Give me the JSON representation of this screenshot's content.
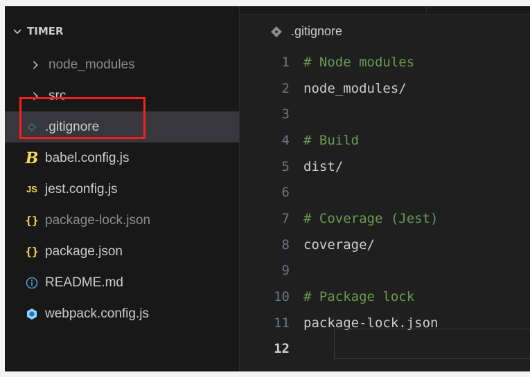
{
  "explorer": {
    "root_label": "TIMER",
    "items": [
      {
        "type": "folder",
        "label": "node_modules",
        "icon": "chevron-right-icon",
        "dimmed": true
      },
      {
        "type": "folder",
        "label": "src",
        "icon": "chevron-right-icon"
      },
      {
        "type": "file",
        "label": ".gitignore",
        "icon": "git-icon",
        "selected": true
      },
      {
        "type": "file",
        "label": "babel.config.js",
        "icon": "babel-icon",
        "icon_text": "B",
        "icon_color": "#f5da55"
      },
      {
        "type": "file",
        "label": "jest.config.js",
        "icon": "javascript-icon",
        "icon_text": "JS",
        "icon_color": "#f5da55"
      },
      {
        "type": "file",
        "label": "package-lock.json",
        "icon": "json-icon",
        "icon_text": "{}",
        "icon_color": "#f5da55",
        "dimmed": true
      },
      {
        "type": "file",
        "label": "package.json",
        "icon": "json-icon",
        "icon_text": "{}",
        "icon_color": "#f5da55"
      },
      {
        "type": "file",
        "label": "README.md",
        "icon": "info-icon",
        "icon_color": "#519aba"
      },
      {
        "type": "file",
        "label": "webpack.config.js",
        "icon": "webpack-icon",
        "icon_color": "#8ed6fb"
      }
    ]
  },
  "editor": {
    "breadcrumb_file": ".gitignore",
    "active_line": 12,
    "lines": [
      {
        "num": "1",
        "text": "# Node modules",
        "comment": true
      },
      {
        "num": "2",
        "text": "node_modules/",
        "comment": false
      },
      {
        "num": "3",
        "text": "",
        "comment": false
      },
      {
        "num": "4",
        "text": "# Build",
        "comment": true
      },
      {
        "num": "5",
        "text": "dist/",
        "comment": false
      },
      {
        "num": "6",
        "text": "",
        "comment": false
      },
      {
        "num": "7",
        "text": "# Coverage (Jest)",
        "comment": true
      },
      {
        "num": "8",
        "text": "coverage/",
        "comment": false
      },
      {
        "num": "9",
        "text": "",
        "comment": false
      },
      {
        "num": "10",
        "text": "# Package lock",
        "comment": true
      },
      {
        "num": "11",
        "text": "package-lock.json",
        "comment": false
      },
      {
        "num": "12",
        "text": "",
        "comment": false
      }
    ]
  },
  "colors": {
    "background": "#181818",
    "editor_background": "#1f1f1f",
    "selection": "#37373d",
    "highlight_box": "#ff1e1e",
    "comment": "#6a9955",
    "text": "#cccccc",
    "line_number": "#6e7681"
  }
}
